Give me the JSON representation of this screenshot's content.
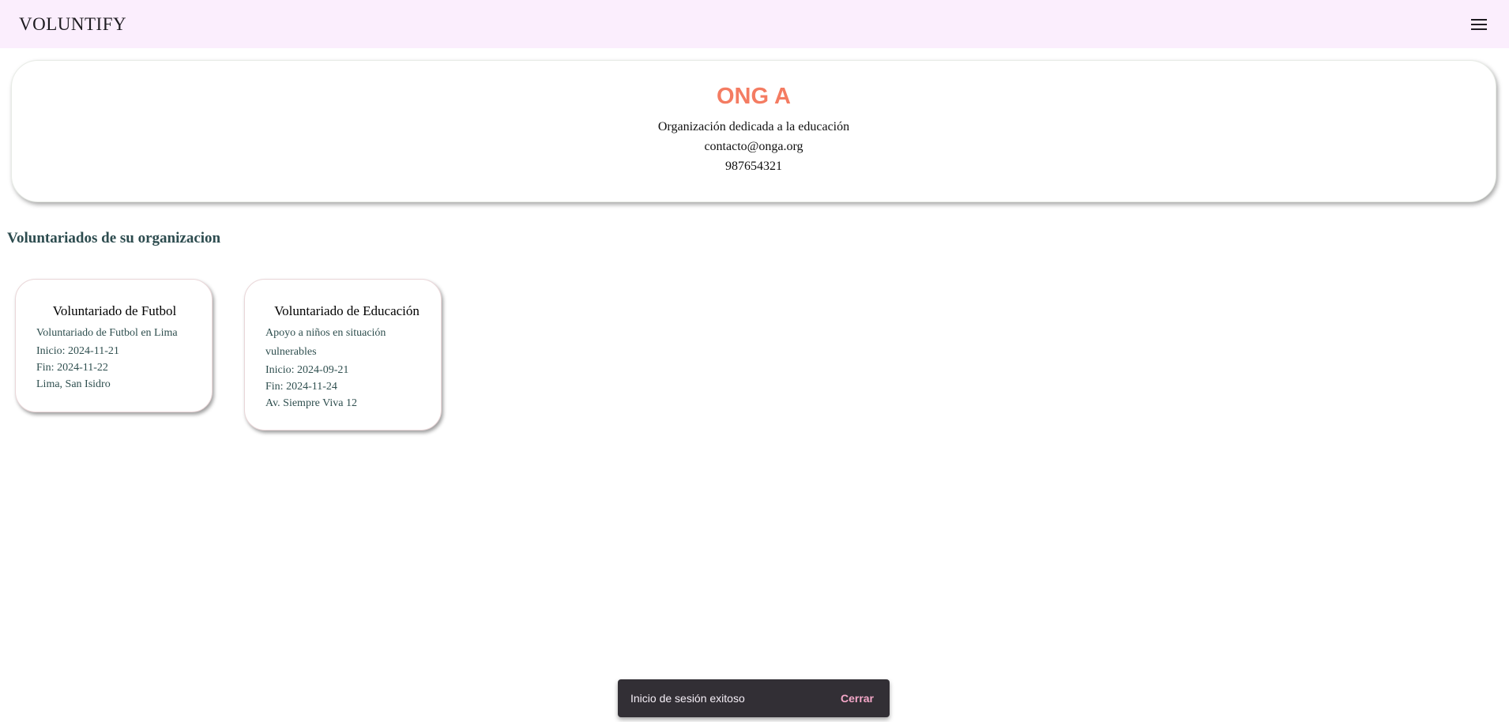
{
  "app": {
    "title": "VOLUNTIFY"
  },
  "icons": {
    "menu": "menu-icon"
  },
  "organization": {
    "name": "ONG A",
    "description": "Organización dedicada a la educación",
    "email": "contacto@onga.org",
    "phone": "987654321"
  },
  "section": {
    "title": "Voluntariados de su organizacion"
  },
  "volunteerings": [
    {
      "title": "Voluntariado de Futbol",
      "description": "Voluntariado de Futbol en Lima",
      "start": "Inicio: 2024-11-21",
      "end": "Fin: 2024-11-22",
      "location": "Lima, San Isidro"
    },
    {
      "title": "Voluntariado de Educación",
      "description": "Apoyo a niños en situación vulnerables",
      "start": "Inicio: 2024-09-21",
      "end": "Fin: 2024-11-24",
      "location": "Av. Siempre Viva 12"
    }
  ],
  "snackbar": {
    "message": "Inicio de sesión exitoso",
    "action": "Cerrar"
  },
  "colors": {
    "toolbar_bg": "#fbeefd",
    "org_name": "#f47c62",
    "section_title": "#2d4c4f",
    "snackbar_bg": "#322f35",
    "snackbar_action": "#f4a7c8"
  }
}
